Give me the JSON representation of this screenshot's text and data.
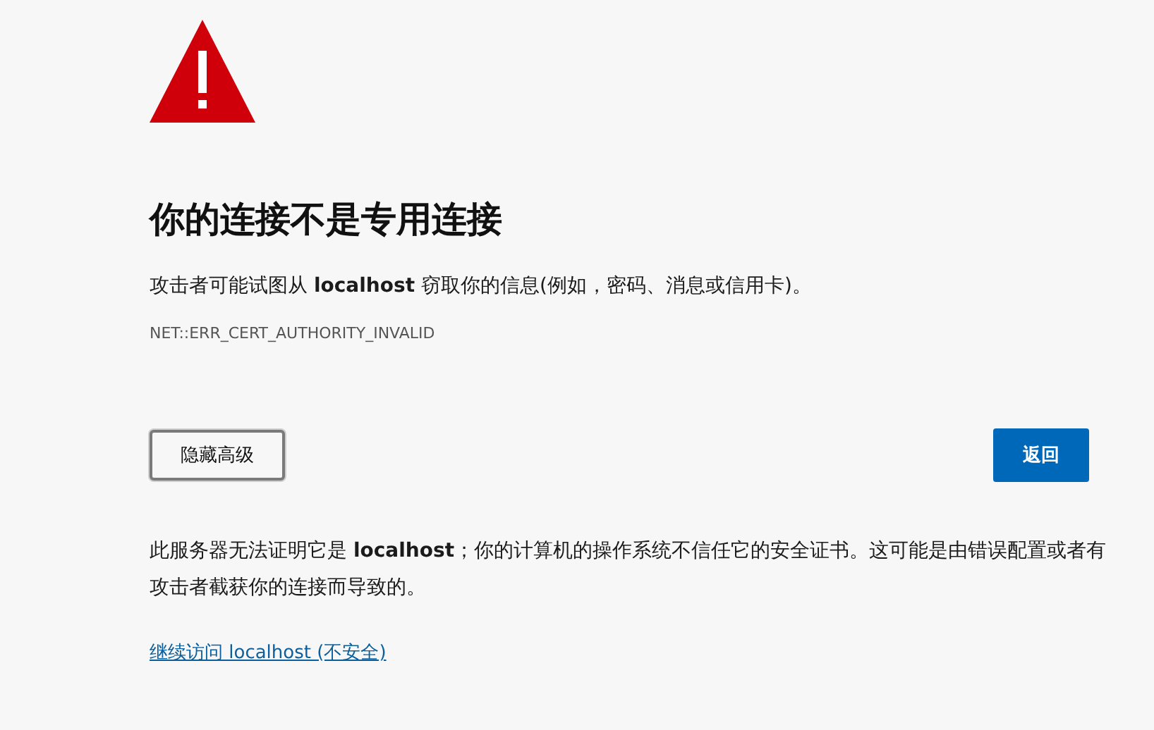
{
  "heading": "你的连接不是专用连接",
  "summary": "攻击者可能试图从 **localhost** 窃取你的信息(例如，密码、消息或信用卡)。",
  "error_code": "NET::ERR_CERT_AUTHORITY_INVALID",
  "buttons": [
    {
      "kind": "secondary",
      "label": "隐藏高级"
    },
    {
      "kind": "primary",
      "label": "返回"
    }
  ],
  "details": "此服务器无法证明它是 **localhost**；你的计算机的操作系统不信任它的安全证书。这可能是由错误配置或者有攻击者截获你的连接而导致的。",
  "proceed_link": "继续访问 localhost (不安全)"
}
